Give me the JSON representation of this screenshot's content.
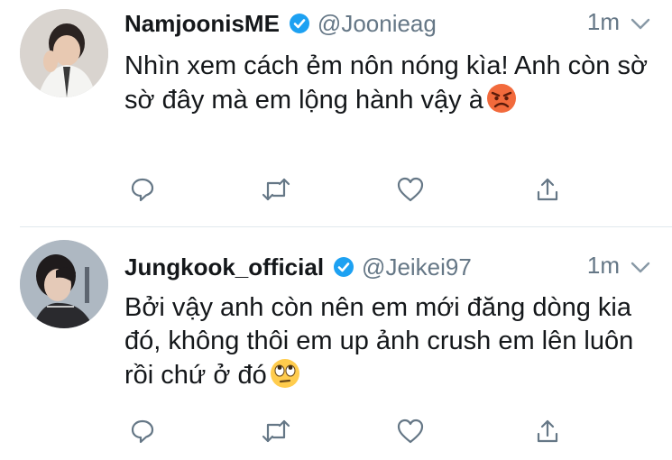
{
  "tweets": [
    {
      "display_name": "NamjoonisME",
      "handle": "@Joonieag",
      "time": "1m",
      "text": "Nhìn xem cách ẻm nôn nóng kìa! Anh còn sờ sờ đây mà em lộng hành vậy à",
      "emoji": "angry-face-emoji",
      "verified": true
    },
    {
      "display_name": "Jungkook_official",
      "handle": "@Jeikei97",
      "time": "1m",
      "text": "Bởi vậy anh còn nên em mới đăng dòng kia đó, không thôi em up ảnh crush em lên luôn rồi chứ ở đó",
      "emoji": "rolling-eyes-emoji",
      "verified": true
    }
  ],
  "icons": {
    "reply": "reply-icon",
    "retweet": "retweet-icon",
    "like": "like-icon",
    "share": "share-icon",
    "verified": "verified-badge-icon",
    "caret": "chevron-down-icon"
  },
  "colors": {
    "text": "#14171a",
    "secondary": "#657786",
    "verified": "#1da1f2",
    "divider": "#e1e8ed"
  }
}
